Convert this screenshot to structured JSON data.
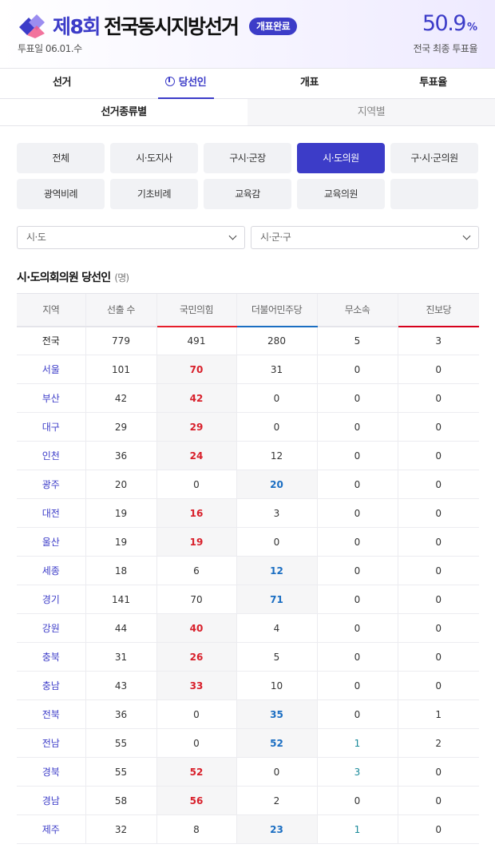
{
  "header": {
    "title_number": "제8회",
    "title_text": "전국동시지방선거",
    "status_badge": "개표완료",
    "vote_date": "투표일 06.01.수",
    "turnout_value": "50.9",
    "turnout_unit": "%",
    "turnout_label": "전국 최종 투표율",
    "accent_color": "#3c3cc8"
  },
  "main_tabs": [
    {
      "label": "선거",
      "active": false
    },
    {
      "label": "당선인",
      "active": true,
      "icon": "ballot-icon"
    },
    {
      "label": "개표",
      "active": false
    },
    {
      "label": "투표율",
      "active": false
    }
  ],
  "sub_tabs": [
    {
      "label": "선거종류별",
      "active": true
    },
    {
      "label": "지역별",
      "active": false
    }
  ],
  "election_types": [
    "전체",
    "시·도지사",
    "구시·군장",
    "시·도의원",
    "구·시·군의원",
    "광역비례",
    "기초비례",
    "교육감",
    "교육의원",
    ""
  ],
  "election_types_active": "시·도의원",
  "filters": {
    "sido_placeholder": "시·도",
    "sigungu_placeholder": "시·군·구"
  },
  "section": {
    "title": "시·도의회의원 당선인",
    "unit": "(명)"
  },
  "table": {
    "headers": [
      "지역",
      "선출 수",
      "국민의힘",
      "더불어민주당",
      "무소속",
      "진보당"
    ],
    "party_colors": {
      "국민의힘": "#e61e2b",
      "더불어민주당": "#1b6ec2",
      "진보당": "#d6001c"
    },
    "rows": [
      {
        "region": "전국",
        "seats": "779",
        "ppp": "491",
        "dem": "280",
        "ind": "5",
        "prog": "3",
        "winner": ""
      },
      {
        "region": "서울",
        "seats": "101",
        "ppp": "70",
        "dem": "31",
        "ind": "0",
        "prog": "0",
        "winner": "ppp"
      },
      {
        "region": "부산",
        "seats": "42",
        "ppp": "42",
        "dem": "0",
        "ind": "0",
        "prog": "0",
        "winner": "ppp"
      },
      {
        "region": "대구",
        "seats": "29",
        "ppp": "29",
        "dem": "0",
        "ind": "0",
        "prog": "0",
        "winner": "ppp"
      },
      {
        "region": "인천",
        "seats": "36",
        "ppp": "24",
        "dem": "12",
        "ind": "0",
        "prog": "0",
        "winner": "ppp"
      },
      {
        "region": "광주",
        "seats": "20",
        "ppp": "0",
        "dem": "20",
        "ind": "0",
        "prog": "0",
        "winner": "dem"
      },
      {
        "region": "대전",
        "seats": "19",
        "ppp": "16",
        "dem": "3",
        "ind": "0",
        "prog": "0",
        "winner": "ppp"
      },
      {
        "region": "울산",
        "seats": "19",
        "ppp": "19",
        "dem": "0",
        "ind": "0",
        "prog": "0",
        "winner": "ppp"
      },
      {
        "region": "세종",
        "seats": "18",
        "ppp": "6",
        "dem": "12",
        "ind": "0",
        "prog": "0",
        "winner": "dem"
      },
      {
        "region": "경기",
        "seats": "141",
        "ppp": "70",
        "dem": "71",
        "ind": "0",
        "prog": "0",
        "winner": "dem"
      },
      {
        "region": "강원",
        "seats": "44",
        "ppp": "40",
        "dem": "4",
        "ind": "0",
        "prog": "0",
        "winner": "ppp"
      },
      {
        "region": "충북",
        "seats": "31",
        "ppp": "26",
        "dem": "5",
        "ind": "0",
        "prog": "0",
        "winner": "ppp"
      },
      {
        "region": "충남",
        "seats": "43",
        "ppp": "33",
        "dem": "10",
        "ind": "0",
        "prog": "0",
        "winner": "ppp"
      },
      {
        "region": "전북",
        "seats": "36",
        "ppp": "0",
        "dem": "35",
        "ind": "0",
        "prog": "1",
        "winner": "dem"
      },
      {
        "region": "전남",
        "seats": "55",
        "ppp": "0",
        "dem": "52",
        "ind": "1",
        "prog": "2",
        "winner": "dem"
      },
      {
        "region": "경북",
        "seats": "55",
        "ppp": "52",
        "dem": "0",
        "ind": "3",
        "prog": "0",
        "winner": "ppp"
      },
      {
        "region": "경남",
        "seats": "58",
        "ppp": "56",
        "dem": "2",
        "ind": "0",
        "prog": "0",
        "winner": "ppp"
      },
      {
        "region": "제주",
        "seats": "32",
        "ppp": "8",
        "dem": "23",
        "ind": "1",
        "prog": "0",
        "winner": "dem"
      }
    ]
  }
}
